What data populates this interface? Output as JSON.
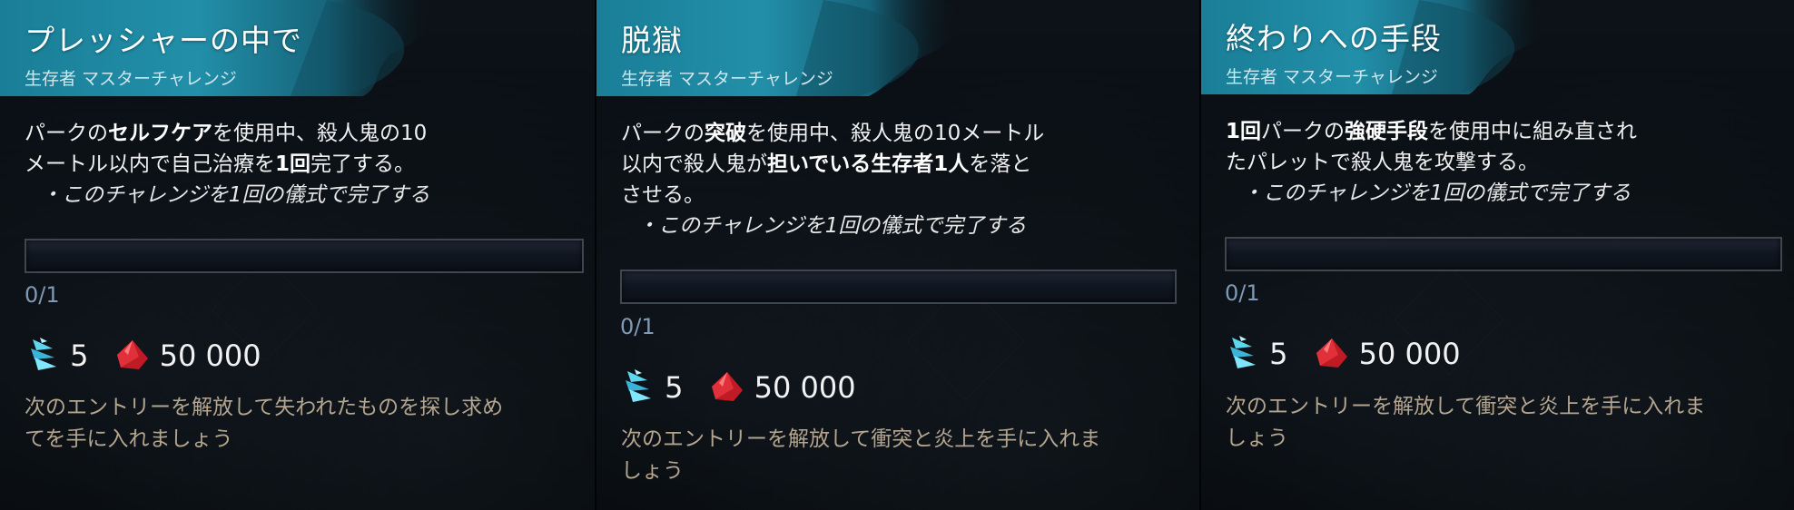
{
  "challenges": [
    {
      "title": "プレッシャーの中で",
      "category": "生存者 マスターチャレンジ",
      "description_lines": [
        [
          {
            "text": "パークの",
            "bold": false
          },
          {
            "text": "セルフケア",
            "bold": true
          },
          {
            "text": "を使用中、殺人鬼の10",
            "bold": false
          }
        ],
        [
          {
            "text": "メートル以内で自己治療を",
            "bold": false
          },
          {
            "text": "1回",
            "bold": true
          },
          {
            "text": "完了する。",
            "bold": false
          }
        ]
      ],
      "note": "・このチャレンジを1回の儀式で完了する",
      "progress_text": "0/1",
      "progress_value": 0,
      "shards": "5",
      "bloodpoints": "50 000",
      "unlock_lines": [
        "次のエントリーを解放して失われたものを探し求め",
        "てを手に入れましょう"
      ]
    },
    {
      "title": "脱獄",
      "category": "生存者 マスターチャレンジ",
      "description_lines": [
        [
          {
            "text": "パークの",
            "bold": false
          },
          {
            "text": "突破",
            "bold": true
          },
          {
            "text": "を使用中、殺人鬼の10メートル",
            "bold": false
          }
        ],
        [
          {
            "text": "以内で殺人鬼が",
            "bold": false
          },
          {
            "text": "担いでいる生存者1人",
            "bold": true
          },
          {
            "text": "を落と",
            "bold": false
          }
        ],
        [
          {
            "text": "させる。",
            "bold": false
          }
        ]
      ],
      "note": "・このチャレンジを1回の儀式で完了する",
      "progress_text": "0/1",
      "progress_value": 0,
      "shards": "5",
      "bloodpoints": "50 000",
      "unlock_lines": [
        "次のエントリーを解放して衝突と炎上を手に入れま",
        "しょう"
      ]
    },
    {
      "title": "終わりへの手段",
      "category": "生存者 マスターチャレンジ",
      "description_lines": [
        [
          {
            "text": "1回",
            "bold": true
          },
          {
            "text": "パークの",
            "bold": false
          },
          {
            "text": "強硬手段",
            "bold": true
          },
          {
            "text": "を使用中に組み直され",
            "bold": false
          }
        ],
        [
          {
            "text": "たパレットで殺人鬼を攻撃する。",
            "bold": false
          }
        ]
      ],
      "note": "・このチャレンジを1回の儀式で完了する",
      "progress_text": "0/1",
      "progress_value": 0,
      "shards": "5",
      "bloodpoints": "50 000",
      "unlock_lines": [
        "次のエントリーを解放して衝突と炎上を手に入れま",
        "しょう"
      ]
    }
  ],
  "icons": {
    "shard": "rift-fragment-icon",
    "bloodpoints": "bloodpoint-gem-icon"
  },
  "colors": {
    "header_teal": "#1f8ca6",
    "title_text": "#ffffff",
    "progress_text": "#7f9ab6",
    "unlock_text": "#b3a58f",
    "bloodpoint_red": "#c01a25",
    "shard_cyan": "#5fd6f0"
  }
}
